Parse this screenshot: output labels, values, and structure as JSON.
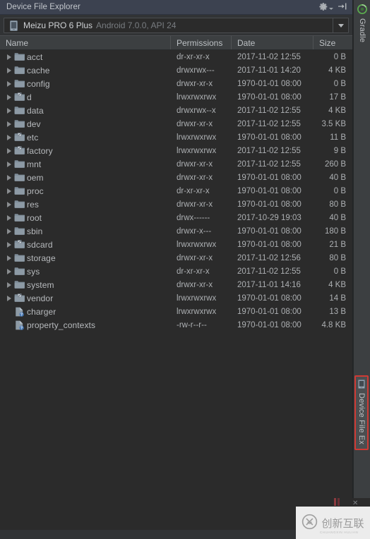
{
  "window": {
    "title": "Device File Explorer",
    "settings_icon": "gear-icon",
    "hide_icon": "hide-window-icon"
  },
  "device": {
    "icon": "phone-icon",
    "name": "Meizu PRO 6 Plus",
    "meta": "Android 7.0.0, API 24",
    "dropdown_icon": "chevron-down-icon"
  },
  "table": {
    "columns": [
      "Name",
      "Permissions",
      "Date",
      "Size"
    ],
    "rows": [
      {
        "name": "acct",
        "type": "folder",
        "expandable": true,
        "permissions": "dr-xr-xr-x",
        "date": "2017-11-02 12:55",
        "size": "0 B"
      },
      {
        "name": "cache",
        "type": "folder",
        "expandable": true,
        "permissions": "drwxrwx---",
        "date": "2017-11-01 14:20",
        "size": "4 KB"
      },
      {
        "name": "config",
        "type": "folder",
        "expandable": true,
        "permissions": "drwxr-xr-x",
        "date": "1970-01-01 08:00",
        "size": "0 B"
      },
      {
        "name": "d",
        "type": "symlink-folder",
        "expandable": true,
        "permissions": "lrwxrwxrwx",
        "date": "1970-01-01 08:00",
        "size": "17 B"
      },
      {
        "name": "data",
        "type": "folder",
        "expandable": true,
        "permissions": "drwxrwx--x",
        "date": "2017-11-02 12:55",
        "size": "4 KB"
      },
      {
        "name": "dev",
        "type": "folder",
        "expandable": true,
        "permissions": "drwxr-xr-x",
        "date": "2017-11-02 12:55",
        "size": "3.5 KB"
      },
      {
        "name": "etc",
        "type": "symlink-folder",
        "expandable": true,
        "permissions": "lrwxrwxrwx",
        "date": "1970-01-01 08:00",
        "size": "11 B"
      },
      {
        "name": "factory",
        "type": "symlink-folder",
        "expandable": true,
        "permissions": "lrwxrwxrwx",
        "date": "2017-11-02 12:55",
        "size": "9 B"
      },
      {
        "name": "mnt",
        "type": "folder",
        "expandable": true,
        "permissions": "drwxr-xr-x",
        "date": "2017-11-02 12:55",
        "size": "260 B"
      },
      {
        "name": "oem",
        "type": "folder",
        "expandable": true,
        "permissions": "drwxr-xr-x",
        "date": "1970-01-01 08:00",
        "size": "40 B"
      },
      {
        "name": "proc",
        "type": "folder",
        "expandable": true,
        "permissions": "dr-xr-xr-x",
        "date": "1970-01-01 08:00",
        "size": "0 B"
      },
      {
        "name": "res",
        "type": "folder",
        "expandable": true,
        "permissions": "drwxr-xr-x",
        "date": "1970-01-01 08:00",
        "size": "80 B"
      },
      {
        "name": "root",
        "type": "folder",
        "expandable": true,
        "permissions": "drwx------",
        "date": "2017-10-29 19:03",
        "size": "40 B"
      },
      {
        "name": "sbin",
        "type": "folder",
        "expandable": true,
        "permissions": "drwxr-x---",
        "date": "1970-01-01 08:00",
        "size": "180 B"
      },
      {
        "name": "sdcard",
        "type": "symlink-folder",
        "expandable": true,
        "permissions": "lrwxrwxrwx",
        "date": "1970-01-01 08:00",
        "size": "21 B"
      },
      {
        "name": "storage",
        "type": "folder",
        "expandable": true,
        "permissions": "drwxr-xr-x",
        "date": "2017-11-02 12:56",
        "size": "80 B"
      },
      {
        "name": "sys",
        "type": "folder",
        "expandable": true,
        "permissions": "dr-xr-xr-x",
        "date": "2017-11-02 12:55",
        "size": "0 B"
      },
      {
        "name": "system",
        "type": "folder",
        "expandable": true,
        "permissions": "drwxr-xr-x",
        "date": "2017-11-01 14:16",
        "size": "4 KB"
      },
      {
        "name": "vendor",
        "type": "symlink-folder",
        "expandable": true,
        "permissions": "lrwxrwxrwx",
        "date": "1970-01-01 08:00",
        "size": "14 B"
      },
      {
        "name": "charger",
        "type": "file",
        "expandable": false,
        "permissions": "lrwxrwxrwx",
        "date": "1970-01-01 08:00",
        "size": "13 B"
      },
      {
        "name": "property_contexts",
        "type": "file",
        "expandable": false,
        "permissions": "-rw-r--r--",
        "date": "1970-01-01 08:00",
        "size": "4.8 KB"
      }
    ]
  },
  "side_strip": {
    "tabs": [
      {
        "label": "Gradle",
        "icon": "gradle-icon",
        "active": false
      },
      {
        "label": "Device File Ex",
        "icon": "device-file-explorer-icon",
        "active": true
      }
    ]
  },
  "watermark": {
    "logo": "cx-logo-icon",
    "text": "创新互联",
    "subtext": "CHUANGXIN HULIAN"
  },
  "colors": {
    "title_bar": "#3c4250",
    "panel": "#313335",
    "table_bg": "#2b2b2b",
    "header_bg": "#3c3f41",
    "text": "#b7babd",
    "accent_red": "#cf3a34",
    "gradle_green": "#4f9d4c",
    "folder": "#7a8b99"
  }
}
